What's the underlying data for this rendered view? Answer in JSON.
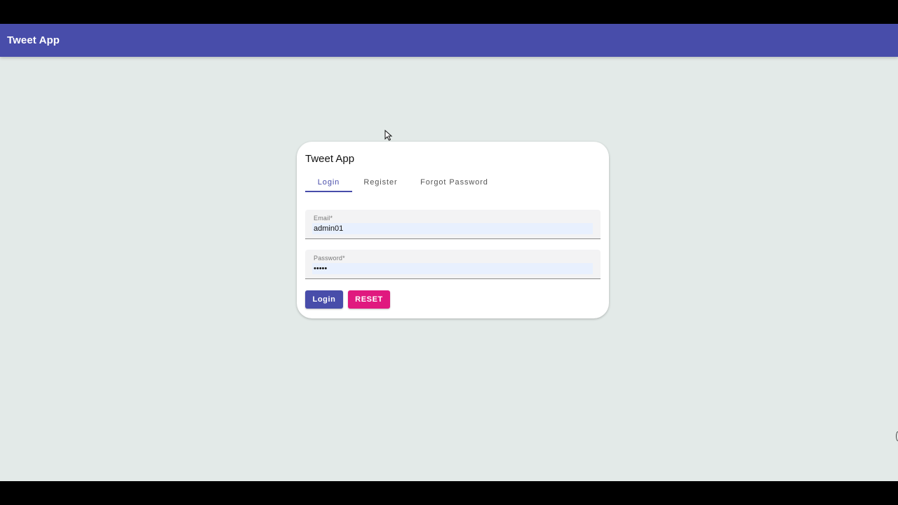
{
  "appbar": {
    "title": "Tweet App"
  },
  "card": {
    "title": "Tweet App",
    "tabs": [
      {
        "label": "Login",
        "active": true
      },
      {
        "label": "Register",
        "active": false
      },
      {
        "label": "Forgot Password",
        "active": false
      }
    ],
    "email": {
      "label": "Email*",
      "value": "admin01"
    },
    "password": {
      "label": "Password*",
      "value": "•••••"
    },
    "buttons": {
      "login": "Login",
      "reset": "RESET"
    }
  },
  "colors": {
    "primary": "#484daa",
    "accent": "#e0197f",
    "background": "#e3eae8"
  },
  "icons": {
    "cursor": "mouse-pointer-icon"
  }
}
